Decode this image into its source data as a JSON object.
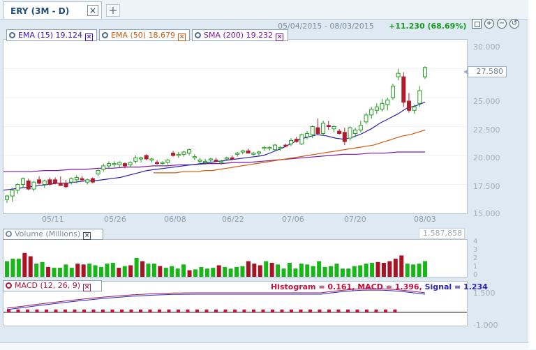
{
  "tab": {
    "title": "ERY (3M - D)",
    "close": "×",
    "add": "+"
  },
  "header": {
    "date_range": "05/04/2015 - 08/03/2015",
    "change": "+11.230 (68.69%)"
  },
  "zoom": {
    "in": "+",
    "out": "−",
    "reset": "↺"
  },
  "legend": [
    {
      "label": "EMA (15) 19.124",
      "color": "#3b14c4"
    },
    {
      "label": "EMA (50) 18.679",
      "color": "#d05a0e"
    },
    {
      "label": "SMA (200) 19.232",
      "color": "#7b16a6"
    }
  ],
  "close_x": "×",
  "price_badge": "27.580",
  "y_ticks": [
    "30.000",
    "27.500",
    "25.000",
    "22.500",
    "20.000",
    "17.500",
    "15.000"
  ],
  "x_ticks": [
    "05/11",
    "05/26",
    "06/08",
    "06/22",
    "07/06",
    "07/20",
    "08/03"
  ],
  "volume": {
    "label": "Volume (Millions)",
    "last": "1,587,858",
    "ticks": [
      "4",
      "3",
      "2",
      "1",
      "0"
    ]
  },
  "macd": {
    "label": "MACD (12, 26, 9)",
    "histogram": "Histogram = 0.161,",
    "macd_value": "MACD = 1.396,",
    "signal": "Signal = 1.234",
    "ticks": [
      "1.500",
      "-1.000"
    ]
  },
  "chart_data": {
    "type": "candlestick",
    "ylim": [
      15,
      30
    ],
    "candles": [
      {
        "o": 16.2,
        "h": 16.6,
        "l": 15.9,
        "c": 16.5
      },
      {
        "o": 16.5,
        "h": 17.2,
        "l": 16.0,
        "c": 17.0
      },
      {
        "o": 17.0,
        "h": 17.6,
        "l": 16.7,
        "c": 17.5
      },
      {
        "o": 17.5,
        "h": 18.1,
        "l": 17.2,
        "c": 18.0
      },
      {
        "o": 17.8,
        "h": 18.0,
        "l": 17.0,
        "c": 17.1
      },
      {
        "o": 17.1,
        "h": 17.8,
        "l": 16.9,
        "c": 17.7
      },
      {
        "o": 17.9,
        "h": 18.2,
        "l": 17.5,
        "c": 17.6
      },
      {
        "o": 17.5,
        "h": 17.9,
        "l": 17.2,
        "c": 17.8
      },
      {
        "o": 17.9,
        "h": 18.1,
        "l": 17.4,
        "c": 17.5
      },
      {
        "o": 17.9,
        "h": 18.1,
        "l": 17.5,
        "c": 17.6
      },
      {
        "o": 17.6,
        "h": 18.2,
        "l": 17.4,
        "c": 17.4
      },
      {
        "o": 17.6,
        "h": 17.9,
        "l": 17.2,
        "c": 17.3
      },
      {
        "o": 17.7,
        "h": 18.1,
        "l": 17.5,
        "c": 18.0
      },
      {
        "o": 17.9,
        "h": 18.3,
        "l": 17.6,
        "c": 18.1
      },
      {
        "o": 18.0,
        "h": 18.2,
        "l": 17.8,
        "c": 17.9
      },
      {
        "o": 17.7,
        "h": 18.0,
        "l": 17.5,
        "c": 17.9
      },
      {
        "o": 18.0,
        "h": 18.1,
        "l": 17.6,
        "c": 17.7
      },
      {
        "o": 18.4,
        "h": 18.8,
        "l": 18.2,
        "c": 18.7
      },
      {
        "o": 18.8,
        "h": 19.3,
        "l": 18.6,
        "c": 19.1
      },
      {
        "o": 19.1,
        "h": 19.5,
        "l": 18.9,
        "c": 19.3
      },
      {
        "o": 19.3,
        "h": 19.5,
        "l": 19.0,
        "c": 19.3
      },
      {
        "o": 19.2,
        "h": 19.5,
        "l": 19.0,
        "c": 19.4
      },
      {
        "o": 19.3,
        "h": 19.4,
        "l": 18.9,
        "c": 19.1
      },
      {
        "o": 19.2,
        "h": 19.5,
        "l": 19.0,
        "c": 19.4
      },
      {
        "o": 19.5,
        "h": 20.0,
        "l": 19.3,
        "c": 19.8
      },
      {
        "o": 19.7,
        "h": 19.9,
        "l": 19.4,
        "c": 19.8
      },
      {
        "o": 20.0,
        "h": 20.1,
        "l": 19.6,
        "c": 19.7
      },
      {
        "o": 19.6,
        "h": 19.8,
        "l": 19.4,
        "c": 19.7
      },
      {
        "o": 19.4,
        "h": 19.6,
        "l": 19.2,
        "c": 19.3
      },
      {
        "o": 19.3,
        "h": 19.5,
        "l": 19.2,
        "c": 19.4
      },
      {
        "o": 19.4,
        "h": 19.7,
        "l": 19.2,
        "c": 19.6
      },
      {
        "o": 20.2,
        "h": 20.4,
        "l": 19.9,
        "c": 20.0
      },
      {
        "o": 20.0,
        "h": 20.3,
        "l": 19.8,
        "c": 20.1
      },
      {
        "o": 20.1,
        "h": 20.4,
        "l": 19.9,
        "c": 20.3
      },
      {
        "o": 20.2,
        "h": 20.6,
        "l": 20.0,
        "c": 20.5
      },
      {
        "o": 19.8,
        "h": 20.1,
        "l": 19.6,
        "c": 19.9
      },
      {
        "o": 19.5,
        "h": 19.8,
        "l": 19.2,
        "c": 19.6
      },
      {
        "o": 19.4,
        "h": 19.7,
        "l": 19.2,
        "c": 19.5
      },
      {
        "o": 19.6,
        "h": 19.8,
        "l": 19.4,
        "c": 19.7
      },
      {
        "o": 19.6,
        "h": 19.8,
        "l": 19.5,
        "c": 19.5
      },
      {
        "o": 19.4,
        "h": 19.6,
        "l": 19.2,
        "c": 19.5
      },
      {
        "o": 19.7,
        "h": 19.9,
        "l": 19.6,
        "c": 19.8
      },
      {
        "o": 19.8,
        "h": 20.0,
        "l": 19.6,
        "c": 19.7
      },
      {
        "o": 20.1,
        "h": 20.3,
        "l": 19.9,
        "c": 20.2
      },
      {
        "o": 20.3,
        "h": 20.5,
        "l": 20.1,
        "c": 20.4
      },
      {
        "o": 20.4,
        "h": 20.6,
        "l": 20.2,
        "c": 20.2
      },
      {
        "o": 20.1,
        "h": 20.3,
        "l": 20.0,
        "c": 20.2
      },
      {
        "o": 20.2,
        "h": 20.4,
        "l": 20.0,
        "c": 20.3
      },
      {
        "o": 20.6,
        "h": 20.8,
        "l": 20.4,
        "c": 20.7
      },
      {
        "o": 20.6,
        "h": 20.8,
        "l": 20.4,
        "c": 20.7
      },
      {
        "o": 20.5,
        "h": 21.0,
        "l": 20.4,
        "c": 20.9
      },
      {
        "o": 20.6,
        "h": 20.8,
        "l": 20.4,
        "c": 20.7
      },
      {
        "o": 20.9,
        "h": 21.0,
        "l": 20.7,
        "c": 20.8
      },
      {
        "o": 21.0,
        "h": 21.5,
        "l": 20.8,
        "c": 21.3
      },
      {
        "o": 21.4,
        "h": 21.6,
        "l": 21.1,
        "c": 21.2
      },
      {
        "o": 21.0,
        "h": 21.9,
        "l": 20.9,
        "c": 21.8
      },
      {
        "o": 21.6,
        "h": 22.1,
        "l": 21.4,
        "c": 21.9
      },
      {
        "o": 21.8,
        "h": 22.6,
        "l": 21.5,
        "c": 22.5
      },
      {
        "o": 22.4,
        "h": 23.2,
        "l": 21.8,
        "c": 21.9
      },
      {
        "o": 21.9,
        "h": 23.0,
        "l": 21.7,
        "c": 22.8
      },
      {
        "o": 22.6,
        "h": 23.0,
        "l": 22.2,
        "c": 22.5
      },
      {
        "o": 22.3,
        "h": 22.6,
        "l": 22.0,
        "c": 22.5
      },
      {
        "o": 22.1,
        "h": 22.3,
        "l": 21.8,
        "c": 21.9
      },
      {
        "o": 22.0,
        "h": 22.4,
        "l": 20.9,
        "c": 21.2
      },
      {
        "o": 21.5,
        "h": 22.5,
        "l": 21.3,
        "c": 22.4
      },
      {
        "o": 21.9,
        "h": 22.4,
        "l": 21.6,
        "c": 22.2
      },
      {
        "o": 22.2,
        "h": 23.0,
        "l": 22.0,
        "c": 22.6
      },
      {
        "o": 22.9,
        "h": 23.7,
        "l": 22.7,
        "c": 23.5
      },
      {
        "o": 23.5,
        "h": 24.2,
        "l": 23.2,
        "c": 24.0
      },
      {
        "o": 23.9,
        "h": 24.5,
        "l": 23.6,
        "c": 24.2
      },
      {
        "o": 24.0,
        "h": 24.9,
        "l": 23.8,
        "c": 24.5
      },
      {
        "o": 24.4,
        "h": 25.0,
        "l": 23.9,
        "c": 24.8
      },
      {
        "o": 25.0,
        "h": 26.2,
        "l": 24.8,
        "c": 26.0
      },
      {
        "o": 26.8,
        "h": 27.5,
        "l": 26.5,
        "c": 27.1
      },
      {
        "o": 26.8,
        "h": 27.2,
        "l": 24.2,
        "c": 24.6
      },
      {
        "o": 24.7,
        "h": 25.4,
        "l": 23.7,
        "c": 23.9
      },
      {
        "o": 23.9,
        "h": 24.4,
        "l": 23.6,
        "c": 24.2
      },
      {
        "o": 24.5,
        "h": 26.0,
        "l": 24.2,
        "c": 25.6
      },
      {
        "o": 26.8,
        "h": 27.7,
        "l": 26.6,
        "c": 27.6
      }
    ],
    "ema15": [
      17.0,
      17.1,
      17.2,
      17.3,
      17.4,
      17.5,
      17.6,
      17.6,
      17.7,
      17.8,
      17.8,
      17.9,
      18.0,
      18.1,
      18.3,
      18.5,
      18.7,
      18.8,
      18.9,
      19.0,
      19.1,
      19.2,
      19.3,
      19.4,
      19.5,
      19.6,
      19.7,
      19.8,
      19.9,
      20.0,
      20.3,
      20.6,
      21.0,
      21.4,
      21.6,
      21.8,
      21.7,
      21.5,
      21.4,
      21.6,
      21.9,
      22.3,
      22.8,
      23.2,
      23.6,
      24.1,
      24.3,
      24.6
    ],
    "ema50": [
      18.5,
      18.5,
      18.5,
      18.5,
      18.6,
      18.6,
      18.6,
      18.7,
      18.7,
      18.8,
      18.9,
      19.0,
      19.1,
      19.2,
      19.3,
      19.4,
      19.5,
      19.6,
      19.7,
      19.8,
      19.9,
      20.0,
      20.1,
      20.2,
      20.3,
      20.4,
      20.5,
      20.6,
      20.7,
      20.8,
      20.9,
      21.1,
      21.3,
      21.5,
      21.7,
      21.8,
      22.0,
      22.2
    ],
    "sma200": [
      18.6,
      18.6,
      18.6,
      18.7,
      18.7,
      18.8,
      18.8,
      18.9,
      18.9,
      19.0,
      19.0,
      19.1,
      19.1,
      19.2,
      19.2,
      19.3,
      19.3,
      19.4,
      19.4,
      19.5,
      19.6,
      19.7,
      19.8,
      19.9,
      20.0,
      20.1,
      20.1,
      20.2,
      20.2,
      20.3,
      20.3,
      20.3
    ],
    "volume": [
      1.9,
      2.2,
      2.2,
      2.9,
      2.5,
      1.6,
      1.8,
      1.2,
      1.1,
      1.1,
      1.5,
      1.1,
      1.6,
      1.5,
      1.6,
      1.4,
      1.2,
      1.6,
      1.7,
      1.1,
      1.3,
      1.4,
      2.3,
      1.9,
      1.6,
      1.6,
      1.3,
      1.1,
      1.3,
      1.0,
      1.5,
      0.8,
      0.9,
      1.2,
      1.0,
      1.1,
      1.4,
      1.2,
      1.0,
      1.2,
      1.3,
      1.9,
      1.6,
      1.4,
      1.9,
      1.7,
      1.5,
      1.0,
      1.7,
      1.0,
      1.6,
      1.5,
      1.3,
      1.9,
      1.2,
      1.3,
      1.6,
      1.0,
      1.0,
      1.3,
      1.4,
      1.6,
      1.7,
      1.8,
      1.7,
      1.9,
      2.2,
      2.6,
      1.6,
      1.5,
      1.6,
      1.9
    ]
  }
}
